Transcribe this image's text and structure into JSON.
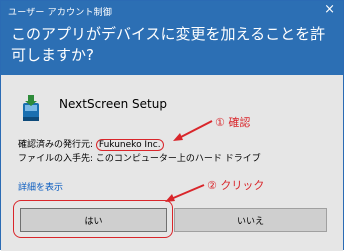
{
  "window": {
    "title": "ユーザー アカウント制御",
    "close_glyph": "×",
    "prompt": "このアプリがデバイスに変更を加えることを許可しますか?"
  },
  "app": {
    "name": "NextScreen Setup",
    "icon": "installer-icon"
  },
  "publisher": {
    "label": "確認済みの発行元: ",
    "name": "Fukuneko Inc."
  },
  "source": {
    "text": "ファイルの入手先: このコンピューター上のハード ドライブ"
  },
  "details_link": "詳細を表示",
  "buttons": {
    "yes": "はい",
    "no": "いいえ"
  },
  "annotations": {
    "step1": "① 確認",
    "step2": "② クリック",
    "color": "#d9262b"
  },
  "colors": {
    "header": "#2c6fb4",
    "body": "#e6e6e6",
    "link": "#0a5cc0"
  }
}
